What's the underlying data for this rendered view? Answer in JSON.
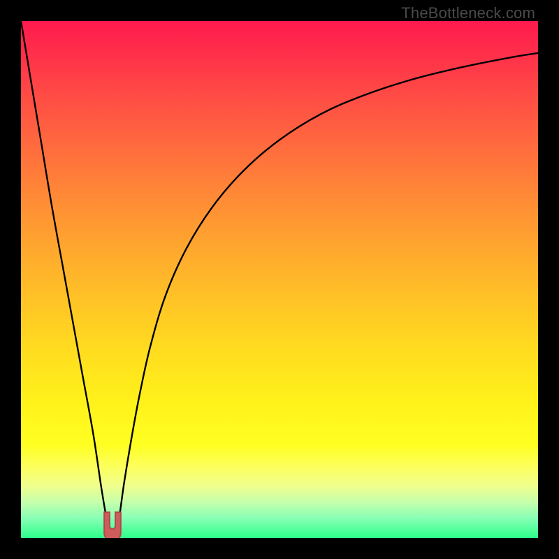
{
  "watermark": "TheBottleneck.com",
  "colors": {
    "frame": "#000000",
    "curve": "#000000",
    "marker_fill": "#cd5c5c",
    "marker_stroke": "#b04848"
  },
  "chart_data": {
    "type": "line",
    "title": "",
    "xlabel": "",
    "ylabel": "",
    "xlim": [
      0,
      100
    ],
    "ylim": [
      0,
      100
    ],
    "grid": false,
    "legend": false,
    "annotations": [],
    "series": [
      {
        "name": "left-branch",
        "x": [
          0,
          2,
          4,
          6,
          8,
          10,
          12,
          14,
          15.5,
          16.5,
          17
        ],
        "y": [
          100,
          88,
          76,
          64,
          53,
          42,
          31,
          20,
          10,
          4,
          1.5
        ]
      },
      {
        "name": "right-branch",
        "x": [
          18.4,
          19,
          20,
          21.5,
          23,
          25,
          28,
          32,
          37,
          43,
          50,
          58,
          66,
          75,
          85,
          95,
          100
        ],
        "y": [
          1.5,
          4,
          11,
          20,
          28,
          37,
          47,
          56,
          64,
          71,
          77,
          82,
          85.5,
          88.5,
          91,
          93,
          93.8
        ]
      }
    ],
    "marker": {
      "shape": "u-notch",
      "center_x": 17.7,
      "base_y": 1.0,
      "outer_top_y": 5.0,
      "inner_bottom_y": 2.3,
      "half_width": 1.6,
      "inner_half_width": 0.55
    }
  }
}
